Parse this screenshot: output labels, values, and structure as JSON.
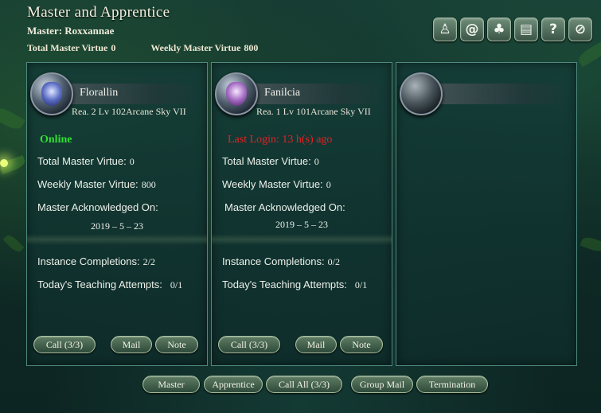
{
  "window": {
    "title": "Master and Apprentice",
    "master_line": "Master: Roxxannae",
    "total_label": "Total Master Virtue",
    "total_value": "0",
    "weekly_label": "Weekly Master Virtue",
    "weekly_value": "800"
  },
  "icon_bar": [
    {
      "name": "figure-icon",
      "glyph": "♙"
    },
    {
      "name": "swirl-icon",
      "glyph": "@"
    },
    {
      "name": "tree-icon",
      "glyph": "♣"
    },
    {
      "name": "scroll-icon",
      "glyph": "▤"
    },
    {
      "name": "help-icon",
      "glyph": "?"
    },
    {
      "name": "close-icon",
      "glyph": "⊘"
    }
  ],
  "apprentices": [
    {
      "name": "Florallin",
      "rank": "Rea. 2 Lv 102Arcane Sky VII",
      "status": "Online",
      "total_label": "Total Master Virtue:",
      "total_value": "0",
      "weekly_label": "Weekly Master Virtue:",
      "weekly_value": "800",
      "ack_label": "Master Acknowledged On:",
      "ack_date": "2019 – 5 – 23",
      "instance_label": "Instance Completions:",
      "instance_value": "2/2",
      "teaching_label": "Today's Teaching Attempts:",
      "teaching_value": "0/1",
      "call_label": "Call (3/3)",
      "mail_label": "Mail",
      "note_label": "Note"
    },
    {
      "name": "Fanilcia",
      "rank": "Rea. 1 Lv 101Arcane Sky VII",
      "status": "Last Login: 13 h(s) ago",
      "total_label": "Total Master Virtue:",
      "total_value": "0",
      "weekly_label": "Weekly Master Virtue:",
      "weekly_value": "0",
      "ack_label": "Master Acknowledged On:",
      "ack_date": "2019 – 5 – 23",
      "instance_label": "Instance Completions:",
      "instance_value": "0/2",
      "teaching_label": "Today's Teaching Attempts:",
      "teaching_value": "0/1",
      "call_label": "Call (3/3)",
      "mail_label": "Mail",
      "note_label": "Note"
    }
  ],
  "bottom_buttons": {
    "master": "Master",
    "apprentice": "Apprentice",
    "call_all": "Call All (3/3)",
    "group_mail": "Group Mail",
    "termination": "Termination"
  },
  "colors": {
    "online": "#2fe02f",
    "offline": "#e82020",
    "panel_border": "#4f8a80"
  }
}
